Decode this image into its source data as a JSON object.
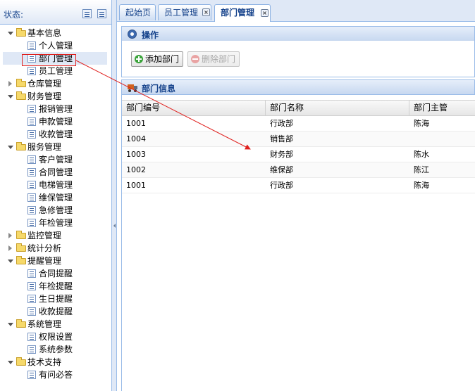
{
  "left_panel": {
    "title": "状态:",
    "tree": [
      {
        "label": "基本信息",
        "type": "folder",
        "expanded": true,
        "level": 0
      },
      {
        "label": "个人管理",
        "type": "leaf",
        "level": 1
      },
      {
        "label": "部门管理",
        "type": "leaf",
        "level": 1,
        "selected": true
      },
      {
        "label": "员工管理",
        "type": "leaf",
        "level": 1
      },
      {
        "label": "仓库管理",
        "type": "folder",
        "expanded": false,
        "level": 0
      },
      {
        "label": "财务管理",
        "type": "folder",
        "expanded": true,
        "level": 0
      },
      {
        "label": "报销管理",
        "type": "leaf",
        "level": 1
      },
      {
        "label": "申款管理",
        "type": "leaf",
        "level": 1
      },
      {
        "label": "收款管理",
        "type": "leaf",
        "level": 1
      },
      {
        "label": "服务管理",
        "type": "folder",
        "expanded": true,
        "level": 0
      },
      {
        "label": "客户管理",
        "type": "leaf",
        "level": 1
      },
      {
        "label": "合同管理",
        "type": "leaf",
        "level": 1
      },
      {
        "label": "电梯管理",
        "type": "leaf",
        "level": 1
      },
      {
        "label": "维保管理",
        "type": "leaf",
        "level": 1
      },
      {
        "label": "急修管理",
        "type": "leaf",
        "level": 1
      },
      {
        "label": "年检管理",
        "type": "leaf",
        "level": 1
      },
      {
        "label": "监控管理",
        "type": "folder",
        "expanded": false,
        "level": 0
      },
      {
        "label": "统计分析",
        "type": "folder",
        "expanded": false,
        "level": 0
      },
      {
        "label": "提醒管理",
        "type": "folder",
        "expanded": true,
        "level": 0
      },
      {
        "label": "合同提醒",
        "type": "leaf",
        "level": 1
      },
      {
        "label": "年检提醒",
        "type": "leaf",
        "level": 1
      },
      {
        "label": "生日提醒",
        "type": "leaf",
        "level": 1
      },
      {
        "label": "收款提醒",
        "type": "leaf",
        "level": 1
      },
      {
        "label": "系统管理",
        "type": "folder",
        "expanded": true,
        "level": 0
      },
      {
        "label": "权限设置",
        "type": "leaf",
        "level": 1
      },
      {
        "label": "系统参数",
        "type": "leaf",
        "level": 1
      },
      {
        "label": "技术支持",
        "type": "folder",
        "expanded": true,
        "level": 0
      },
      {
        "label": "有问必答",
        "type": "leaf",
        "level": 1
      }
    ]
  },
  "tabs": [
    {
      "label": "起始页",
      "closable": false,
      "active": false
    },
    {
      "label": "员工管理",
      "closable": true,
      "active": false
    },
    {
      "label": "部门管理",
      "closable": true,
      "active": true
    }
  ],
  "operations": {
    "title": "操作",
    "add_label": "添加部门",
    "delete_label": "删除部门"
  },
  "department_info": {
    "title": "部门信息",
    "columns": [
      "部门编号",
      "部门名称",
      "部门主管"
    ],
    "rows": [
      [
        "1001",
        "行政部",
        "陈海"
      ],
      [
        "1004",
        "销售部",
        ""
      ],
      [
        "1003",
        "财务部",
        "陈水"
      ],
      [
        "1002",
        "维保部",
        "陈江"
      ],
      [
        "1001",
        "行政部",
        "陈海"
      ]
    ]
  },
  "colors": {
    "header_blue": "#15428b",
    "border_blue": "#99bbe8",
    "annotation_red": "#e0201e"
  }
}
